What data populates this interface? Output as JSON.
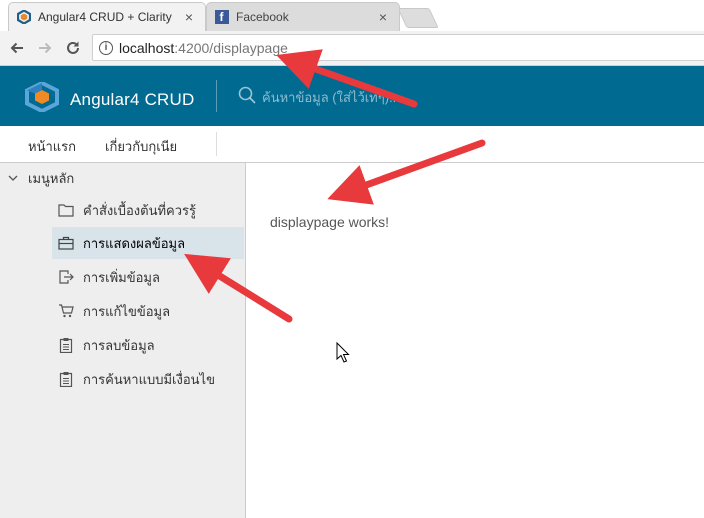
{
  "browser": {
    "tabs": [
      {
        "title": "Angular4 CRUD + Clarity",
        "icon": "clarity-logo-icon",
        "active": true
      },
      {
        "title": "Facebook",
        "icon": "facebook-icon",
        "active": false
      }
    ],
    "close_glyph": "×",
    "address": {
      "host": "localhost",
      "path": ":4200/displaypage"
    }
  },
  "app": {
    "brand_title": "Angular4 CRUD",
    "search_placeholder": "ค้นหาข้อมูล (ใส่ไว้เท่ๆ)...",
    "subnav": [
      {
        "label": "หน้าแรก"
      },
      {
        "label": "เกี่ยวกับกุเนีย"
      }
    ],
    "sidebar": {
      "group_label": "เมนูหลัก",
      "items": [
        {
          "label": "คำสั่งเบื้องต้นที่ควรรู้",
          "icon": "folder-icon",
          "active": false
        },
        {
          "label": "การแสดงผลข้อมูล",
          "icon": "briefcase-icon",
          "active": true
        },
        {
          "label": "การเพิ่มข้อมูล",
          "icon": "export-icon",
          "active": false
        },
        {
          "label": "การแก้ไขข้อมูล",
          "icon": "cart-icon",
          "active": false
        },
        {
          "label": "การลบข้อมูล",
          "icon": "clipboard-icon",
          "active": false
        },
        {
          "label": "การค้นหาแบบมีเงื่อนไข",
          "icon": "clipboard-icon",
          "active": false
        }
      ]
    },
    "content": {
      "message": "displaypage works!"
    }
  },
  "colors": {
    "header_bg": "#006a91",
    "active_item_bg": "#d8e3ea",
    "annotation_arrow": "#e8393c"
  }
}
